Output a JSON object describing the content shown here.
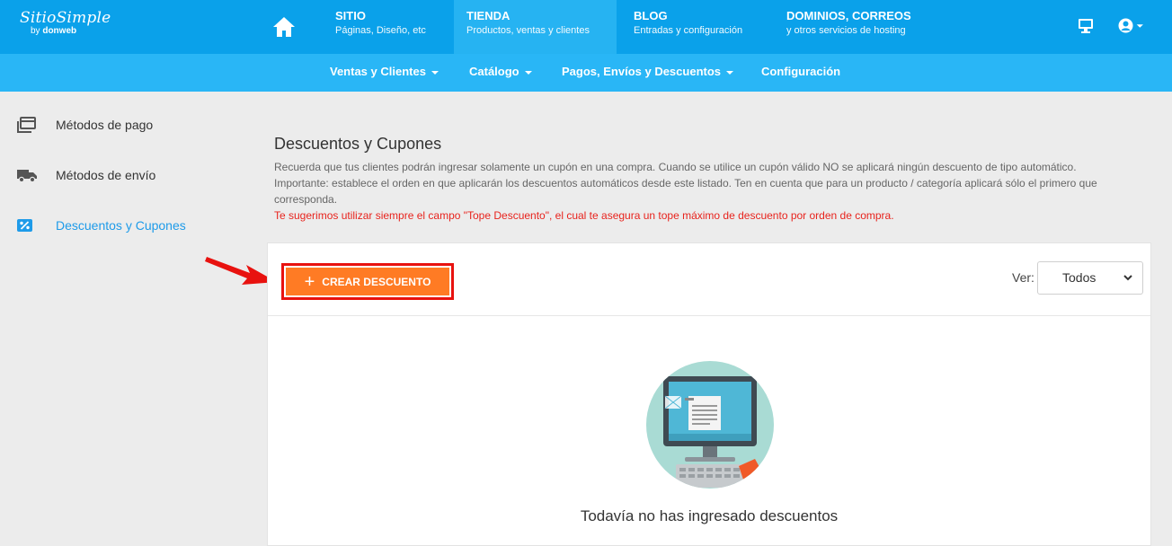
{
  "brand": {
    "name": "SitioSimple",
    "by": "by",
    "company": "donweb"
  },
  "topnav": [
    {
      "title": "SITIO",
      "subtitle": "Páginas, Diseño, etc"
    },
    {
      "title": "TIENDA",
      "subtitle": "Productos, ventas y clientes"
    },
    {
      "title": "BLOG",
      "subtitle": "Entradas y configuración"
    },
    {
      "title": "DOMINIOS, CORREOS",
      "subtitle": "y otros servicios de hosting"
    }
  ],
  "subnav": [
    {
      "label": "Ventas y Clientes"
    },
    {
      "label": "Catálogo"
    },
    {
      "label": "Pagos, Envíos y Descuentos"
    },
    {
      "label": "Configuración"
    }
  ],
  "sidebar": [
    {
      "label": "Métodos de pago",
      "icon": "payment-cards-icon"
    },
    {
      "label": "Métodos de envío",
      "icon": "truck-icon"
    },
    {
      "label": "Descuentos y Cupones",
      "icon": "discount-percent-icon"
    }
  ],
  "main": {
    "title": "Descuentos y Cupones",
    "desc1": "Recuerda que tus clientes podrán ingresar solamente un cupón en una compra. Cuando se utilice un cupón válido NO se aplicará ningún descuento de tipo automático.",
    "desc2": "Importante: establece el orden en que aplicarán los descuentos automáticos desde este listado. Ten en cuenta que para un producto / categoría aplicará sólo el primero que corresponda.",
    "warning": "Te sugerimos utilizar siempre el campo \"Tope Descuento\", el cual te asegura un tope máximo de descuento por orden de compra.",
    "create_button": "CREAR DESCUENTO",
    "ver_label": "Ver:",
    "ver_value": "Todos",
    "empty_text": "Todavía no has ingresado descuentos"
  },
  "colors": {
    "topbar": "#0aa1ea",
    "subbar": "#29b6f6",
    "accent": "#ff7b24",
    "highlight": "#e8120f",
    "active_link": "#1e9be9"
  }
}
